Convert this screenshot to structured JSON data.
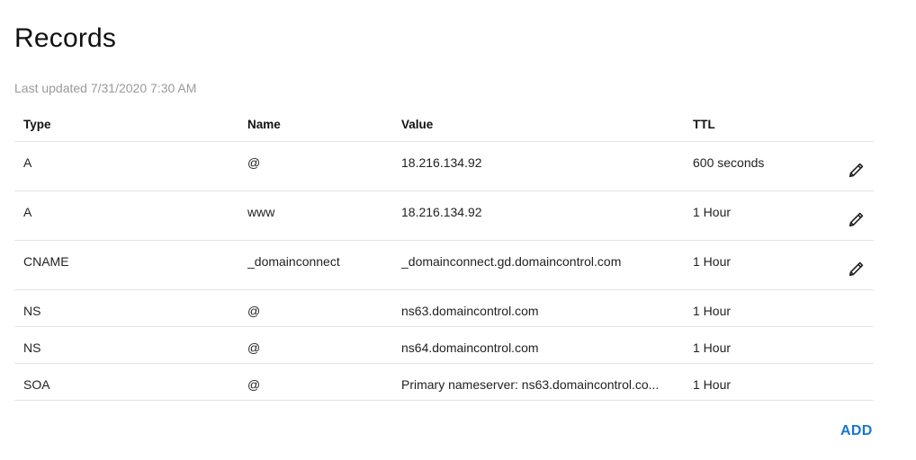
{
  "page": {
    "title": "Records",
    "last_updated": "Last updated 7/31/2020 7:30 AM"
  },
  "table": {
    "headers": {
      "type": "Type",
      "name": "Name",
      "value": "Value",
      "ttl": "TTL"
    },
    "rows": [
      {
        "type": "A",
        "name": "@",
        "value": "18.216.134.92",
        "ttl": "600 seconds",
        "editable": true
      },
      {
        "type": "A",
        "name": "www",
        "value": "18.216.134.92",
        "ttl": "1 Hour",
        "editable": true
      },
      {
        "type": "CNAME",
        "name": "_domainconnect",
        "value": "_domainconnect.gd.domaincontrol.com",
        "ttl": "1 Hour",
        "editable": true
      },
      {
        "type": "NS",
        "name": "@",
        "value": "ns63.domaincontrol.com",
        "ttl": "1 Hour",
        "editable": false
      },
      {
        "type": "NS",
        "name": "@",
        "value": "ns64.domaincontrol.com",
        "ttl": "1 Hour",
        "editable": false
      },
      {
        "type": "SOA",
        "name": "@",
        "value": "Primary nameserver: ns63.domaincontrol.co...",
        "ttl": "1 Hour",
        "editable": false
      }
    ],
    "edit_icon": "pencil-icon"
  },
  "actions": {
    "add_label": "ADD"
  },
  "colors": {
    "accent": "#1976d2",
    "muted_text": "#9a9a9a",
    "divider": "#e3e3e3"
  }
}
